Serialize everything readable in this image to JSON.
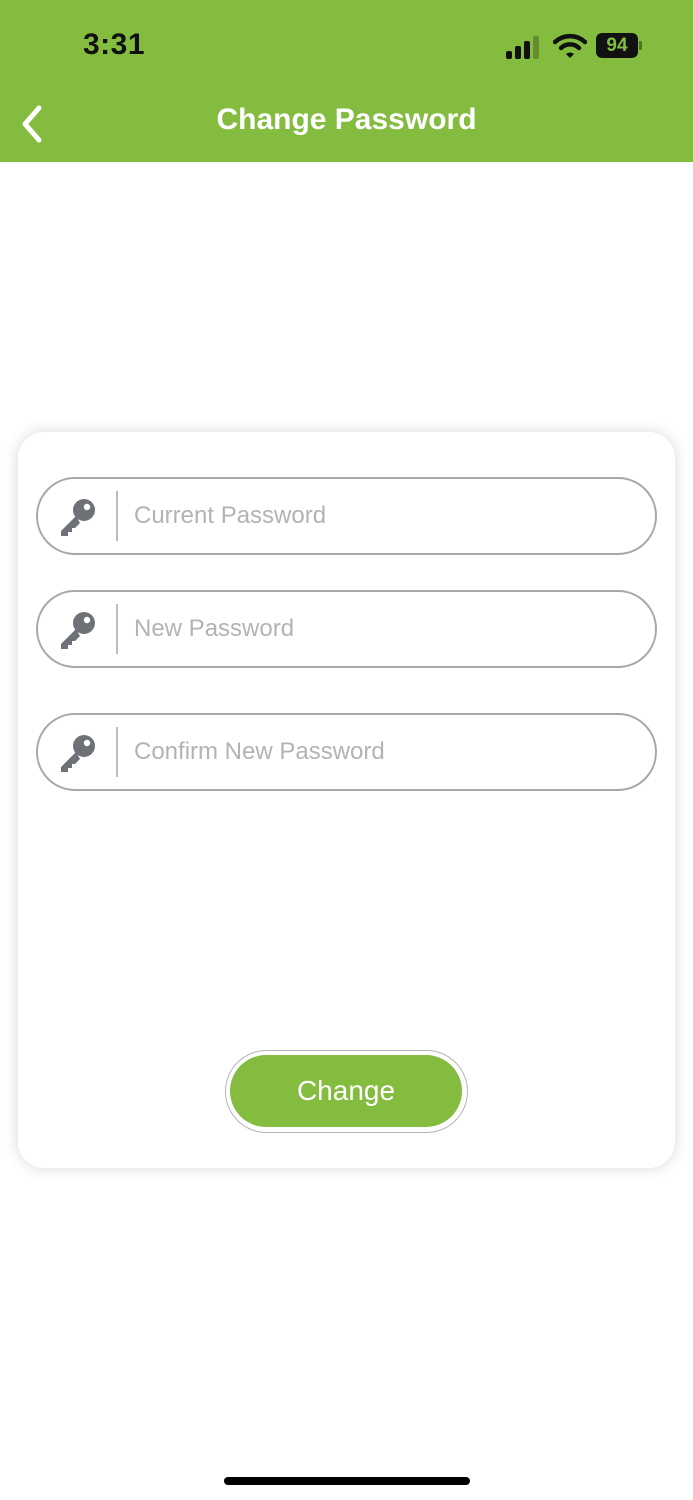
{
  "status_bar": {
    "time": "3:31",
    "battery_level": "94",
    "signal_icon": "cellular-signal-icon",
    "wifi_icon": "wifi-icon"
  },
  "nav": {
    "title": "Change Password",
    "back_icon": "chevron-left-icon"
  },
  "form": {
    "fields": [
      {
        "placeholder": "Current Password",
        "value": "",
        "icon": "key-icon"
      },
      {
        "placeholder": "New Password",
        "value": "",
        "icon": "key-icon"
      },
      {
        "placeholder": "Confirm New Password",
        "value": "",
        "icon": "key-icon"
      }
    ],
    "submit_label": "Change"
  },
  "colors": {
    "accent": "#84bc40",
    "icon_gray": "#6e7176",
    "field_border": "#a8a8a8",
    "placeholder": "#b3b3b3"
  }
}
